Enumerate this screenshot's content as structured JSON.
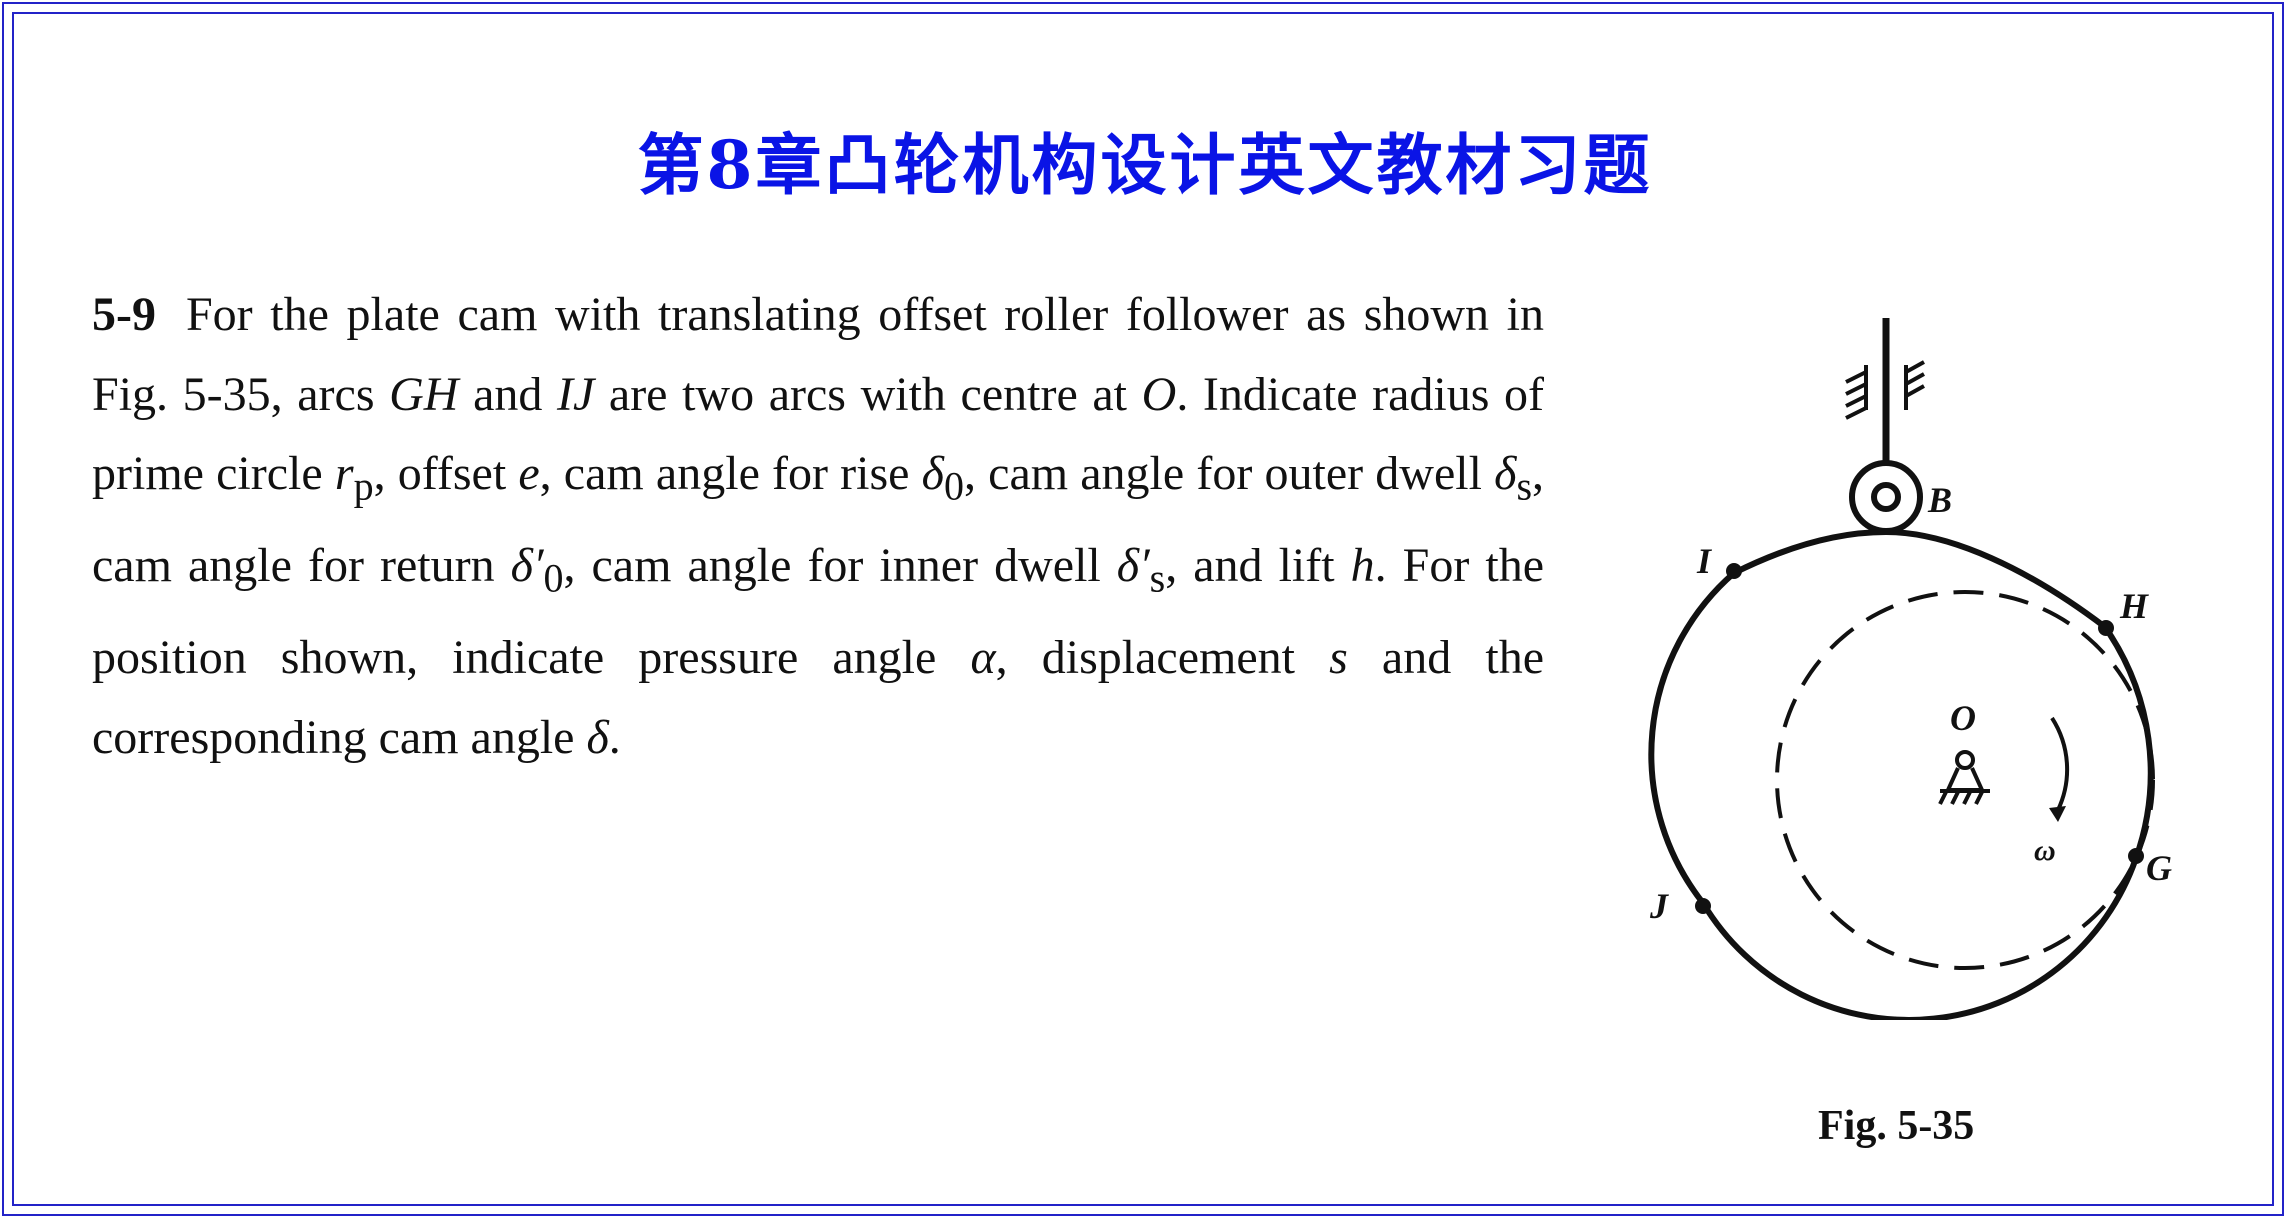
{
  "title": "第8章凸轮机构设计英文教材习题",
  "problem": {
    "number": "5-9",
    "text_1": "For the plate cam with translating offset roller follower as shown in Fig. 5-35, arcs ",
    "gh": "GH",
    "text_2": " and ",
    "ij": "IJ",
    "text_3": " are two arcs with centre at ",
    "o": "O",
    "text_4": ". Indicate radius of prime circle ",
    "rp": "r",
    "rp_sub": "p",
    "text_5": ", offset ",
    "e": "e",
    "text_6": ", cam angle for rise ",
    "delta0": "δ",
    "delta0_sub": "0",
    "text_7": ", cam angle for outer dwell ",
    "deltas": "δ",
    "deltas_sub": "s",
    "text_8": ", cam angle for return ",
    "delta0p": "δ′",
    "delta0p_sub": "0",
    "text_9": ", cam angle for inner dwell ",
    "deltasp": "δ′",
    "deltasp_sub": "s",
    "text_10": ", and lift ",
    "h": "h",
    "text_11": ". For the position shown, indicate pressure angle ",
    "alpha": "α",
    "text_12": ", displacement ",
    "s": "s",
    "text_13": " and the corresponding cam angle ",
    "delta": "δ",
    "text_14": "."
  },
  "figure": {
    "labels": {
      "B": "B",
      "I": "I",
      "H": "H",
      "O": "O",
      "G": "G",
      "J": "J",
      "omega": "ω"
    },
    "caption": "Fig. 5-35"
  },
  "colors": {
    "border": "#2323c8",
    "title": "#0a14e6",
    "text": "#111111"
  }
}
